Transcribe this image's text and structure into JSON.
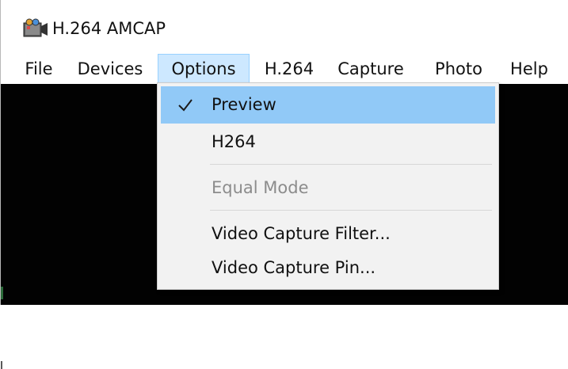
{
  "window": {
    "title": "H.264 AMCAP",
    "icon": "camera-app-icon"
  },
  "menu_bar": {
    "items": [
      {
        "label": "File"
      },
      {
        "label": "Devices"
      },
      {
        "label": "Options",
        "open": true
      },
      {
        "label": "H.264"
      },
      {
        "label": "Capture"
      },
      {
        "label": "Photo"
      },
      {
        "label": "Help"
      }
    ]
  },
  "options_menu": {
    "items": [
      {
        "label": "Preview",
        "checked": true,
        "highlighted": true,
        "enabled": true
      },
      {
        "label": "H264",
        "checked": false,
        "enabled": true
      },
      {
        "label": "Equal Mode",
        "checked": false,
        "enabled": false
      },
      {
        "label": "Video Capture Filter...",
        "enabled": true
      },
      {
        "label": "Video Capture Pin...",
        "enabled": true
      }
    ]
  },
  "colors": {
    "menu_open_bg": "#cde8ff",
    "highlight_bg": "#91c9f7",
    "disabled_text": "#8c8c8c",
    "video_bg": "#020202"
  }
}
